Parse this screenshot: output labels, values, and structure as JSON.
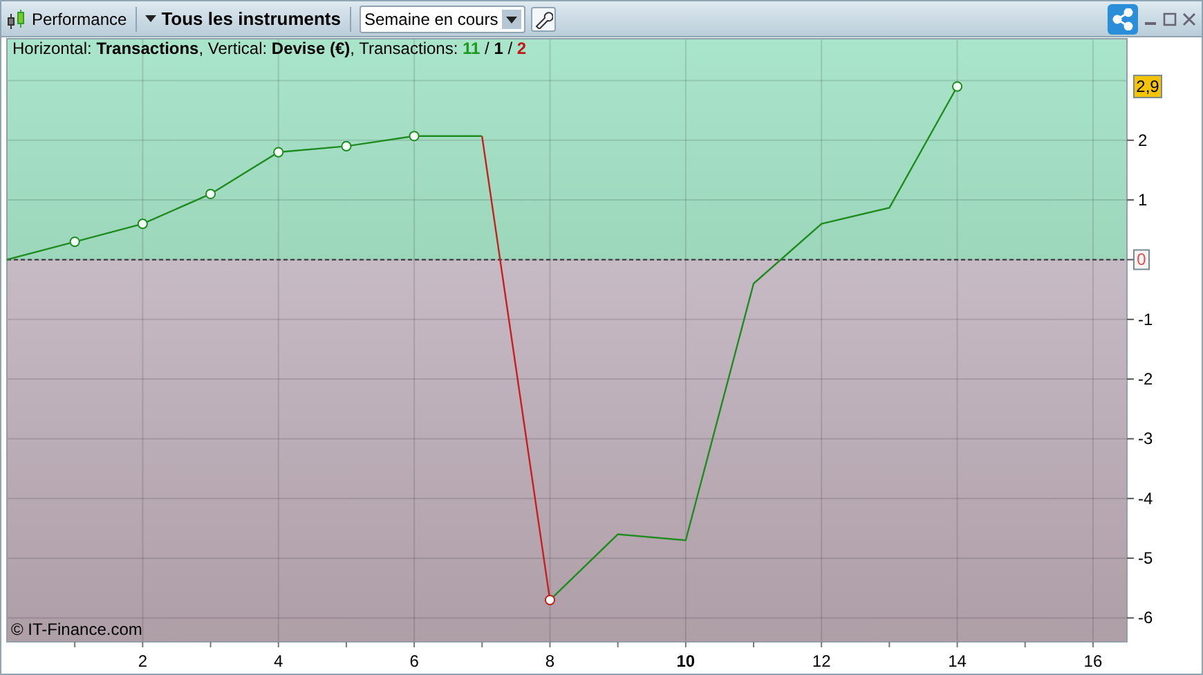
{
  "toolbar": {
    "title": "Performance",
    "instruments": "Tous les instruments",
    "period": {
      "value": "Semaine en cours"
    }
  },
  "info": "Horizontal: **Transactions**, Vertical: **Devise (€)**, Transactions: **11** / **1** / **2**",
  "copyright": "© IT-Finance.com",
  "current_value": "2,9",
  "chart_data": {
    "type": "line",
    "x": [
      0,
      1,
      2,
      3,
      4,
      5,
      6,
      7,
      8,
      9,
      10,
      11,
      12,
      13,
      14
    ],
    "series": [
      {
        "color": "#1e8c1e",
        "values": [
          0,
          0.3,
          0.6,
          1.1,
          1.8,
          1.9,
          2.07,
          2.07,
          null,
          null,
          null,
          null,
          null,
          null,
          null
        ]
      },
      {
        "color": "#c81e1e",
        "values": [
          null,
          null,
          null,
          null,
          null,
          null,
          null,
          2.07,
          -5.7,
          null,
          null,
          null,
          null,
          null,
          null
        ]
      },
      {
        "color": "#1e8c1e",
        "values": [
          null,
          null,
          null,
          null,
          null,
          null,
          null,
          null,
          -5.7,
          -4.6,
          -4.7,
          -0.4,
          0.6,
          0.87,
          2.9
        ]
      },
      {
        "type": "scatter",
        "color": "#1e8c1e",
        "values": [
          null,
          0.3,
          0.6,
          1.1,
          1.8,
          1.9,
          2.07,
          null,
          null,
          null,
          null,
          null,
          null,
          null,
          2.9
        ]
      },
      {
        "type": "scatter",
        "color": "#c81e1e",
        "values": [
          null,
          null,
          null,
          null,
          null,
          null,
          null,
          null,
          -5.7,
          null,
          null,
          null,
          null,
          null,
          null
        ]
      }
    ],
    "ref_lines": [
      {
        "axis": "y",
        "value": 0
      }
    ],
    "grid": true,
    "xlim": [
      0,
      16.5
    ],
    "ylim": [
      -6.4,
      3.7
    ],
    "xticks": [
      2,
      4,
      6,
      8,
      {
        "value": 10,
        "label": "10"
      },
      12,
      14,
      16
    ],
    "yticks": [
      2,
      1,
      0,
      -1,
      -2,
      -3,
      -4,
      -5,
      -6
    ]
  }
}
